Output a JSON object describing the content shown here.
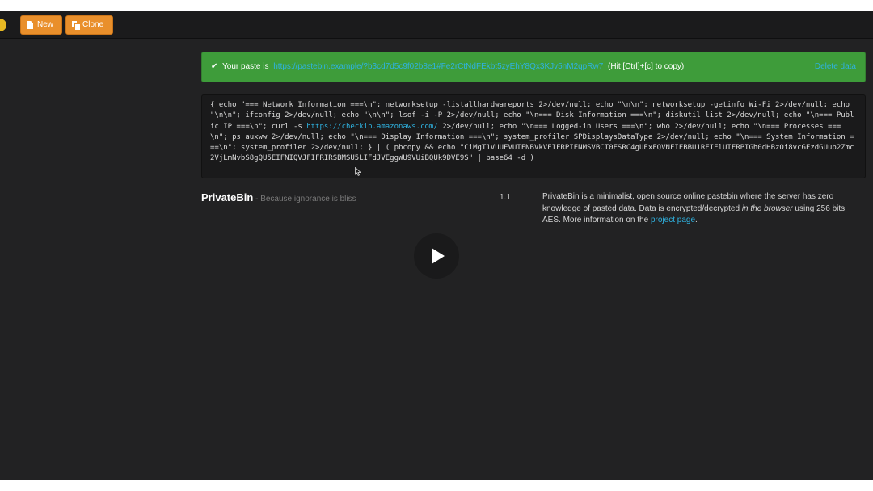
{
  "toolbar": {
    "new_label": "New",
    "clone_label": "Clone",
    "new_icon": "file-icon",
    "clone_icon": "clone-icon",
    "accent_color": "#e98f2b"
  },
  "alert": {
    "prefix": "Your paste is",
    "url": "https://pastebin.example/?b3cd7d5c9f02b8e1#Fe2rCtNdFEkbt5zyEhY8Qx3KJv5nM2qpRw7",
    "hint": "(Hit [Ctrl]+[c] to copy)",
    "delete_label": "Delete data",
    "color": "#3e9c3a"
  },
  "paste": {
    "before_url": "{ echo \"=== Network Information ===\\n\"; networksetup -listallhardwareports 2>/dev/null; echo \"\\n\\n\"; networksetup -getinfo Wi-Fi 2>/dev/null; echo \"\\n\\n\"; ifconfig 2>/dev/null; echo \"\\n\\n\"; lsof -i -P 2>/dev/null; echo \"\\n=== Disk Information ===\\n\"; diskutil list 2>/dev/null; echo \"\\n=== Public IP ===\\n\"; curl -s ",
    "url": "https://checkip.amazonaws.com/",
    "after_url": " 2>/dev/null; echo \"\\n=== Logged-in Users ===\\n\"; who 2>/dev/null; echo \"\\n=== Processes ===\\n\"; ps auxww 2>/dev/null; echo \"\\n=== Display Information ===\\n\"; system_profiler SPDisplaysDataType 2>/dev/null; echo \"\\n=== System Information ===\\n\"; system_profiler 2>/dev/null; } | ( pbcopy && echo \"CiMgT1VUUFVUIFNBVkVEIFRPIENMSVBCT0FSRC4gUExFQVNFIFBBU1RFIElUIFRPIGh0dHBzOi8vcGFzdGUub2Zmc2VjLmNvbS8gQU5EIFNIQVJFIFRIRSBMSU5LIFdJVEggWU9VUiBQUk9DVE9S\" | base64 -d )"
  },
  "footer": {
    "brand": "PrivateBin",
    "tagline": " - Because ignorance is bliss",
    "version": "1.1",
    "about_1": "PrivateBin is a minimalist, open source online pastebin where the server has zero knowledge of pasted data. Data is encrypted/decrypted ",
    "about_em": "in the browser",
    "about_2": " using 256 bits AES. More information on the ",
    "about_link": "project page",
    "about_end": "."
  },
  "video": {
    "play_icon": "play-icon"
  }
}
